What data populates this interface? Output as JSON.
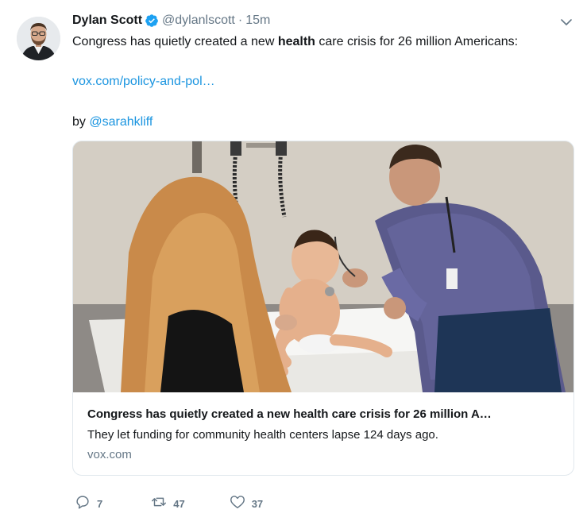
{
  "tweet": {
    "author_name": "Dylan Scott",
    "handle": "@dylanlscott",
    "separator": "·",
    "time": "15m",
    "text_before": "Congress has quietly created a new ",
    "text_bold": "health",
    "text_after": " care crisis for 26 million Americans:",
    "link_text": "vox.com/policy-and-pol…",
    "by_prefix": "by ",
    "mention": "@sarahkliff"
  },
  "card": {
    "title": "Congress has quietly created a new health care crisis for 26 million A…",
    "description": "They let funding for community health centers lapse 124 days ago.",
    "domain": "vox.com"
  },
  "actions": {
    "replies": "7",
    "retweets": "47",
    "likes": "37"
  },
  "icons": {
    "verified": "verified-badge-icon",
    "caret": "chevron-down-icon",
    "reply": "reply-icon",
    "retweet": "retweet-icon",
    "like": "heart-icon"
  },
  "colors": {
    "link": "#1b95e0",
    "muted": "#657786",
    "verified": "#1da1f2",
    "text": "#14171a"
  }
}
